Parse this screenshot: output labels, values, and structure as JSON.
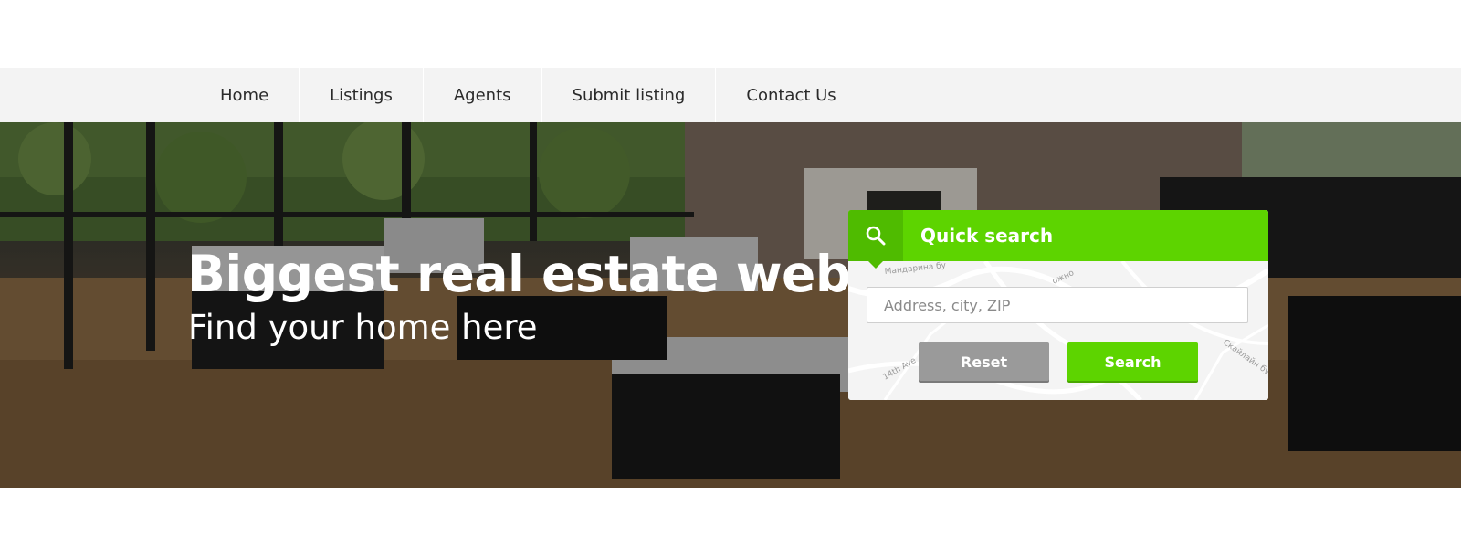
{
  "nav": {
    "items": [
      {
        "label": "Home"
      },
      {
        "label": "Listings"
      },
      {
        "label": "Agents"
      },
      {
        "label": "Submit listing"
      },
      {
        "label": "Contact Us"
      }
    ]
  },
  "hero": {
    "title": "Biggest real estate website",
    "subtitle": "Find your home here"
  },
  "quick_search": {
    "title": "Quick search",
    "icon": "search-icon",
    "input_placeholder": "Address, city, ZIP",
    "input_value": "",
    "reset_label": "Reset",
    "search_label": "Search",
    "map_labels": [
      "Мандарина бу",
      "14th Ave",
      "Скайлайн бу",
      "ожно"
    ]
  },
  "colors": {
    "accent": "#5dd400",
    "accent_dark": "#4fbb00",
    "nav_bg": "#f3f3f3",
    "reset_gray": "#9a9a9a"
  }
}
